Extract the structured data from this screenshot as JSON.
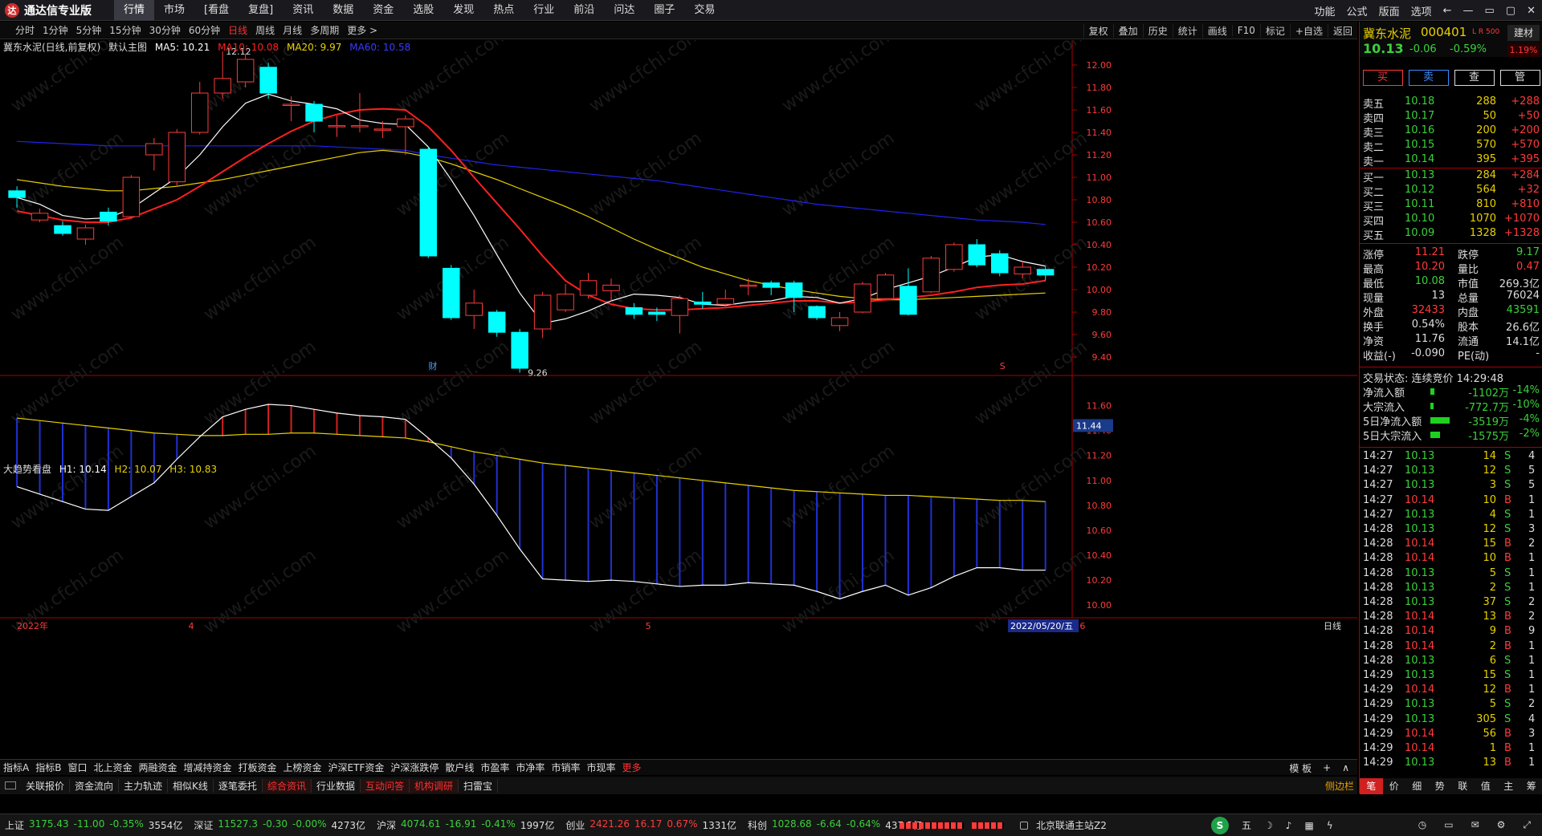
{
  "app": {
    "title": "通达信专业版",
    "logo_icon": "app-logo-icon"
  },
  "menu": [
    "行情",
    "市场",
    "[看盘",
    "复盘]",
    "资讯",
    "数据",
    "资金",
    "选股",
    "发现",
    "热点",
    "行业",
    "前沿",
    "问达",
    "圈子",
    "交易"
  ],
  "menu_right": [
    "功能",
    "公式",
    "版面",
    "选项"
  ],
  "window_icons": [
    "back-icon",
    "restore-icon",
    "minimize-icon",
    "maximize-icon",
    "close-icon"
  ],
  "periods": [
    "分时",
    "1分钟",
    "5分钟",
    "15分钟",
    "30分钟",
    "60分钟",
    "日线",
    "周线",
    "月线",
    "多周期",
    "更多 >"
  ],
  "tools": [
    "复权",
    "叠加",
    "历史",
    "统计",
    "画线",
    "F10",
    "标记",
    "+自选",
    "返回"
  ],
  "chart_info": {
    "name": "冀东水泥(日线,前复权)",
    "template": "默认主图",
    "ma5": "MA5: 10.21",
    "ma10": "MA10: 10.08",
    "ma20": "MA20: 9.97",
    "ma60": "MA60: 10.58"
  },
  "ind_info": {
    "name": "大趋势看盘",
    "h1": "H1: 10.14",
    "h2": "H2: 10.07",
    "h3": "H3: 10.83"
  },
  "annotations": {
    "high": "12.12",
    "low": "9.26",
    "cai": "财",
    "s": "S",
    "date_box": "2022/05/20/五",
    "period": "日线"
  },
  "price_axis": [
    "12.00",
    "11.80",
    "11.60",
    "11.40",
    "11.20",
    "11.00",
    "10.80",
    "10.60",
    "10.40",
    "10.20",
    "10.00",
    "9.80",
    "9.60",
    "9.40"
  ],
  "ind_axis": [
    "11.60",
    "11.40",
    "11.20",
    "11.00",
    "10.80",
    "10.60",
    "10.40",
    "10.20",
    "10.00"
  ],
  "ind_current": "11.44",
  "date_axis": [
    {
      "label": "2022年",
      "pos": 0
    },
    {
      "label": "4",
      "pos": 7.5
    },
    {
      "label": "5",
      "pos": 27.5
    },
    {
      "label": "6",
      "pos": 46.5
    }
  ],
  "colors": {
    "up": "#ff3b3b",
    "down": "#00ffff",
    "ma5": "#ffffff",
    "ma10": "#ff2020",
    "ma20": "#e8d100",
    "ma60": "#2222ee"
  },
  "chart_data": {
    "type": "candlestick",
    "ylim": [
      9.25,
      12.15
    ],
    "candles": [
      [
        10.88,
        10.82,
        10.92,
        10.73
      ],
      [
        10.62,
        10.68,
        10.72,
        10.6
      ],
      [
        10.57,
        10.5,
        10.61,
        10.48
      ],
      [
        10.45,
        10.55,
        10.58,
        10.4
      ],
      [
        10.69,
        10.61,
        10.73,
        10.57
      ],
      [
        10.65,
        11.0,
        11.02,
        10.63
      ],
      [
        11.2,
        11.3,
        11.35,
        11.06
      ],
      [
        10.96,
        11.4,
        11.43,
        10.92
      ],
      [
        11.4,
        11.75,
        11.85,
        11.38
      ],
      [
        11.75,
        11.88,
        12.12,
        11.7
      ],
      [
        11.85,
        12.05,
        12.1,
        11.8
      ],
      [
        11.98,
        11.75,
        12.02,
        11.7
      ],
      [
        11.65,
        11.65,
        11.72,
        11.5
      ],
      [
        11.65,
        11.5,
        11.68,
        11.4
      ],
      [
        11.46,
        11.46,
        11.55,
        11.36
      ],
      [
        11.46,
        11.46,
        11.75,
        11.4
      ],
      [
        11.43,
        11.43,
        11.5,
        11.35
      ],
      [
        11.45,
        11.52,
        11.55,
        11.2
      ],
      [
        11.25,
        10.3,
        11.27,
        10.28
      ],
      [
        10.19,
        9.75,
        10.22,
        9.73
      ],
      [
        9.77,
        9.88,
        10.0,
        9.65
      ],
      [
        9.8,
        9.62,
        9.82,
        9.58
      ],
      [
        9.62,
        9.3,
        9.65,
        9.26
      ],
      [
        9.65,
        9.95,
        9.98,
        9.57
      ],
      [
        9.82,
        9.96,
        10.05,
        9.8
      ],
      [
        9.95,
        10.08,
        10.15,
        9.92
      ],
      [
        9.99,
        10.04,
        10.1,
        9.9
      ],
      [
        9.84,
        9.78,
        9.88,
        9.74
      ],
      [
        9.8,
        9.78,
        9.84,
        9.72
      ],
      [
        9.77,
        9.92,
        9.95,
        9.61
      ],
      [
        9.89,
        9.87,
        9.98,
        9.83
      ],
      [
        9.87,
        9.92,
        10.0,
        9.85
      ],
      [
        10.04,
        10.04,
        10.1,
        9.95
      ],
      [
        10.06,
        10.02,
        10.08,
        9.95
      ],
      [
        10.06,
        9.93,
        10.08,
        9.8
      ],
      [
        9.85,
        9.75,
        9.86,
        9.73
      ],
      [
        9.68,
        9.75,
        9.8,
        9.63
      ],
      [
        9.8,
        10.05,
        10.07,
        9.79
      ],
      [
        9.92,
        10.13,
        10.15,
        9.91
      ],
      [
        10.03,
        9.78,
        10.19,
        9.77
      ],
      [
        9.98,
        10.28,
        10.3,
        9.97
      ],
      [
        10.18,
        10.4,
        10.42,
        10.16
      ],
      [
        10.4,
        10.22,
        10.45,
        10.2
      ],
      [
        10.32,
        10.15,
        10.35,
        10.12
      ],
      [
        10.14,
        10.2,
        10.25,
        10.1
      ],
      [
        10.18,
        10.13,
        10.21,
        10.08
      ]
    ],
    "ma5": [
      10.82,
      10.76,
      10.66,
      10.63,
      10.64,
      10.72,
      10.86,
      11.0,
      11.2,
      11.45,
      11.66,
      11.74,
      11.68,
      11.65,
      11.61,
      11.51,
      11.48,
      11.47,
      11.27,
      10.98,
      10.66,
      10.31,
      9.97,
      9.7,
      9.74,
      9.81,
      9.9,
      9.96,
      9.95,
      9.93,
      9.87,
      9.86,
      9.89,
      9.9,
      9.94,
      9.93,
      9.88,
      9.92,
      10.0,
      10.06,
      10.12,
      10.2,
      10.29,
      10.31,
      10.25,
      10.21
    ],
    "ma10": [
      10.7,
      10.66,
      10.62,
      10.6,
      10.6,
      10.64,
      10.72,
      10.8,
      10.92,
      11.05,
      11.18,
      11.3,
      11.41,
      11.5,
      11.56,
      11.6,
      11.61,
      11.6,
      11.45,
      11.24,
      11.0,
      10.77,
      10.54,
      10.3,
      10.08,
      9.95,
      9.87,
      9.83,
      9.82,
      9.82,
      9.83,
      9.84,
      9.86,
      9.88,
      9.9,
      9.9,
      9.88,
      9.89,
      9.91,
      9.93,
      9.95,
      9.98,
      10.02,
      10.04,
      10.05,
      10.08
    ],
    "ma20": [
      10.98,
      10.95,
      10.92,
      10.9,
      10.88,
      10.88,
      10.9,
      10.92,
      10.95,
      10.98,
      11.02,
      11.06,
      11.1,
      11.14,
      11.18,
      11.22,
      11.24,
      11.22,
      11.18,
      11.12,
      11.05,
      10.98,
      10.9,
      10.82,
      10.74,
      10.65,
      10.55,
      10.45,
      10.36,
      10.28,
      10.2,
      10.14,
      10.08,
      10.04,
      10.0,
      9.97,
      9.94,
      9.92,
      9.91,
      9.91,
      9.92,
      9.93,
      9.94,
      9.95,
      9.96,
      9.97
    ],
    "ma60": [
      11.32,
      11.31,
      11.3,
      11.29,
      11.28,
      11.28,
      11.28,
      11.28,
      11.28,
      11.28,
      11.28,
      11.28,
      11.28,
      11.28,
      11.27,
      11.26,
      11.25,
      11.24,
      11.2,
      11.17,
      11.14,
      11.11,
      11.09,
      11.07,
      11.05,
      11.03,
      11.01,
      10.99,
      10.97,
      10.94,
      10.91,
      10.88,
      10.85,
      10.82,
      10.79,
      10.76,
      10.74,
      10.72,
      10.7,
      10.68,
      10.66,
      10.64,
      10.62,
      10.61,
      10.6,
      10.58
    ],
    "ind_ylim": [
      9.95,
      11.7
    ],
    "ind_white": [
      10.95,
      10.89,
      10.83,
      10.77,
      10.76,
      10.87,
      10.98,
      11.17,
      11.35,
      11.51,
      11.57,
      11.61,
      11.6,
      11.57,
      11.54,
      11.52,
      11.51,
      11.49,
      11.34,
      11.18,
      10.97,
      10.72,
      10.45,
      10.21,
      10.2,
      10.19,
      10.2,
      10.19,
      10.17,
      10.15,
      10.16,
      10.16,
      10.18,
      10.17,
      10.16,
      10.11,
      10.05,
      10.11,
      10.16,
      10.08,
      10.14,
      10.23,
      10.3,
      10.3,
      10.28,
      10.28
    ],
    "ind_yellow": [
      11.5,
      11.48,
      11.46,
      11.44,
      11.42,
      11.4,
      11.38,
      11.37,
      11.36,
      11.36,
      11.37,
      11.37,
      11.38,
      11.38,
      11.37,
      11.36,
      11.35,
      11.34,
      11.31,
      11.27,
      11.23,
      11.2,
      11.17,
      11.14,
      11.12,
      11.1,
      11.08,
      11.06,
      11.04,
      11.02,
      11.0,
      10.98,
      10.96,
      10.94,
      10.92,
      10.91,
      10.9,
      10.89,
      10.88,
      10.88,
      10.87,
      10.86,
      10.85,
      10.84,
      10.84,
      10.83
    ]
  },
  "quote": {
    "name": "冀东水泥",
    "code": "000401",
    "lr": "L R 500",
    "industry": "建材",
    "price": "10.13",
    "change": "-0.06",
    "pct": "-0.59%",
    "ratio": "1.19%",
    "buttons": [
      "买",
      "卖",
      "查",
      "管"
    ],
    "asks": [
      [
        "卖五",
        "10.18",
        "288",
        "+288"
      ],
      [
        "卖四",
        "10.17",
        "50",
        "+50"
      ],
      [
        "卖三",
        "10.16",
        "200",
        "+200"
      ],
      [
        "卖二",
        "10.15",
        "570",
        "+570"
      ],
      [
        "卖一",
        "10.14",
        "395",
        "+395"
      ]
    ],
    "bids": [
      [
        "买一",
        "10.13",
        "284",
        "+284"
      ],
      [
        "买二",
        "10.12",
        "564",
        "+32"
      ],
      [
        "买三",
        "10.11",
        "810",
        "+810"
      ],
      [
        "买四",
        "10.10",
        "1070",
        "+1070"
      ],
      [
        "买五",
        "10.09",
        "1328",
        "+1328"
      ]
    ],
    "stats": [
      [
        "涨停",
        "11.21",
        "跌停",
        "9.17"
      ],
      [
        "最高",
        "10.20",
        "量比",
        "0.47"
      ],
      [
        "最低",
        "10.08",
        "市值",
        "269.3亿"
      ],
      [
        "现量",
        "13",
        "总量",
        "76024"
      ],
      [
        "外盘",
        "32433",
        "内盘",
        "43591"
      ],
      [
        "换手",
        "0.54%",
        "股本",
        "26.6亿"
      ],
      [
        "净资",
        "11.76",
        "流通",
        "14.1亿"
      ],
      [
        "收益(-)",
        "-0.090",
        "PE(动)",
        "-"
      ]
    ],
    "status": "交易状态: 连续竞价 14:29:48",
    "flows": [
      [
        "净流入额",
        "-1102万",
        "-14%",
        0.12
      ],
      [
        "大宗流入",
        "-772.7万",
        "-10%",
        0.08
      ],
      [
        "5日净流入额",
        "-3519万",
        "-4%",
        0.9
      ],
      [
        "5日大宗流入",
        "-1575万",
        "-2%",
        0.4
      ]
    ]
  },
  "ticks": [
    [
      "14:27",
      "10.13",
      "14",
      "S",
      "4"
    ],
    [
      "14:27",
      "10.13",
      "12",
      "S",
      "5"
    ],
    [
      "14:27",
      "10.13",
      "3",
      "S",
      "5"
    ],
    [
      "14:27",
      "10.14",
      "10",
      "B",
      "1"
    ],
    [
      "14:27",
      "10.13",
      "4",
      "S",
      "1"
    ],
    [
      "14:28",
      "10.13",
      "12",
      "S",
      "3"
    ],
    [
      "14:28",
      "10.14",
      "15",
      "B",
      "2"
    ],
    [
      "14:28",
      "10.14",
      "10",
      "B",
      "1"
    ],
    [
      "14:28",
      "10.13",
      "5",
      "S",
      "1"
    ],
    [
      "14:28",
      "10.13",
      "2",
      "S",
      "1"
    ],
    [
      "14:28",
      "10.13",
      "37",
      "S",
      "2"
    ],
    [
      "14:28",
      "10.14",
      "13",
      "B",
      "2"
    ],
    [
      "14:28",
      "10.14",
      "9",
      "B",
      "9"
    ],
    [
      "14:28",
      "10.14",
      "2",
      "B",
      "1"
    ],
    [
      "14:28",
      "10.13",
      "6",
      "S",
      "1"
    ],
    [
      "14:29",
      "10.13",
      "15",
      "S",
      "1"
    ],
    [
      "14:29",
      "10.14",
      "12",
      "B",
      "1"
    ],
    [
      "14:29",
      "10.13",
      "5",
      "S",
      "2"
    ],
    [
      "14:29",
      "10.13",
      "305",
      "S",
      "4"
    ],
    [
      "14:29",
      "10.14",
      "56",
      "B",
      "3"
    ],
    [
      "14:29",
      "10.14",
      "1",
      "B",
      "1"
    ],
    [
      "14:29",
      "10.13",
      "13",
      "B",
      "1"
    ]
  ],
  "rp_tabs": [
    "笔",
    "价",
    "细",
    "势",
    "联",
    "值",
    "主",
    "筹"
  ],
  "funcs": [
    "指标A",
    "指标B",
    "窗口",
    "北上资金",
    "两融资金",
    "增减持资金",
    "打板资金",
    "上榜资金",
    "沪深ETF资金",
    "沪深涨跌停",
    "散户线",
    "市盈率",
    "市净率",
    "市销率",
    "市现率",
    "更多"
  ],
  "func_right": [
    "模 板",
    "+",
    "∧"
  ],
  "tabs": [
    "关联报价",
    "资金流向",
    "主力轨迹",
    "相似K线",
    "逐笔委托",
    "综合资讯",
    "行业数据",
    "互动问答",
    "机构调研",
    "扫雷宝"
  ],
  "sidebar_label": "侧边栏",
  "status": [
    {
      "name": "上证",
      "price": "3175.43",
      "chg": "-11.00",
      "pct": "-0.35%",
      "amt": "3554亿",
      "dir": "dn"
    },
    {
      "name": "深证",
      "price": "11527.3",
      "chg": "-0.30",
      "pct": "-0.00%",
      "amt": "4273亿",
      "dir": "dn"
    },
    {
      "name": "沪深",
      "price": "4074.61",
      "chg": "-16.91",
      "pct": "-0.41%",
      "amt": "1997亿",
      "dir": "dn"
    },
    {
      "name": "创业",
      "price": "2421.26",
      "chg": "16.17",
      "pct": "0.67%",
      "amt": "1331亿",
      "dir": "up"
    },
    {
      "name": "科创",
      "price": "1028.68",
      "chg": "-6.64",
      "pct": "-0.64%",
      "amt": "437.3亿",
      "dir": "dn"
    }
  ],
  "server": "北京联通主站Z2",
  "status_icons": [
    "wu-label",
    "moon-icon",
    "note-icon",
    "calendar-icon",
    "lightning-icon"
  ]
}
